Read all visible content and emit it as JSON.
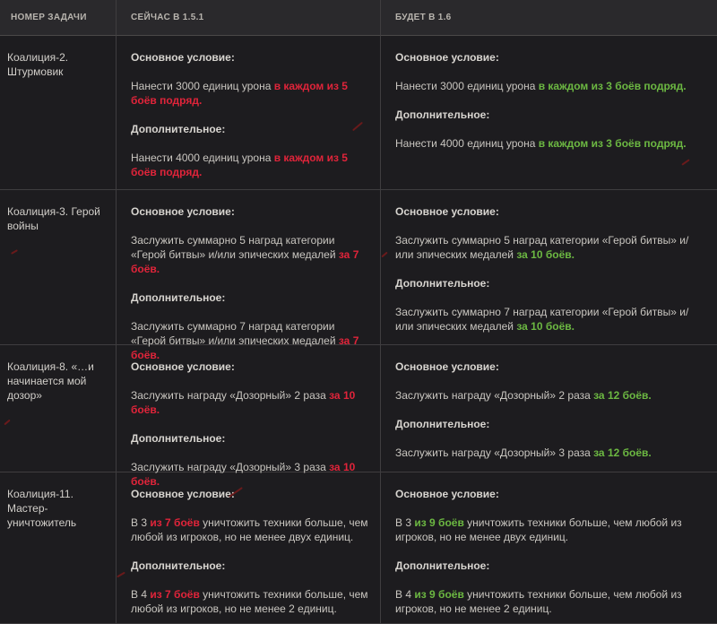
{
  "header": {
    "col1": "НОМЕР ЗАДАЧИ",
    "col2": "СЕЙЧАС В 1.5.1",
    "col3": "БУДЕТ В 1.6"
  },
  "rows": [
    {
      "name": "Коалиция-2. Штурмовик",
      "now": {
        "main_label": "Основное условие:",
        "main_text": "Нанести 3000 единиц урона ",
        "main_hl": "в каждом из 5 боёв подряд.",
        "add_label": "Дополнительное:",
        "add_text": "Нанести 4000 единиц урона ",
        "add_hl": "в каждом из 5 боёв подряд."
      },
      "next": {
        "main_label": "Основное условие:",
        "main_text": "Нанести 3000 единиц урона ",
        "main_hl": "в каждом из 3 боёв подряд.",
        "add_label": "Дополнительное:",
        "add_text": "Нанести 4000 единиц урона ",
        "add_hl": "в каждом из 3 боёв подряд."
      }
    },
    {
      "name": "Коалиция-3. Герой войны",
      "now": {
        "main_label": "Основное условие:",
        "main_text": "Заслужить суммарно 5 наград категории «Герой битвы» и/или эпических медалей ",
        "main_hl": "за 7 боёв.",
        "add_label": "Дополнительное:",
        "add_text": "Заслужить суммарно 7 наград категории «Герой битвы» и/или эпических медалей ",
        "add_hl": "за 7 боёв."
      },
      "next": {
        "main_label": "Основное условие:",
        "main_text": "Заслужить суммарно 5 наград категории «Герой битвы» и/или эпических медалей ",
        "main_hl": "за 10 боёв.",
        "add_label": "Дополнительное:",
        "add_text": "Заслужить суммарно 7 наград категории «Герой битвы» и/или эпических медалей ",
        "add_hl": "за 10 боёв."
      }
    },
    {
      "name": "Коалиция-8. «…и начинается мой дозор»",
      "now": {
        "main_label": "Основное условие:",
        "main_text": "Заслужить награду «Дозорный» 2 раза ",
        "main_hl": "за 10 боёв.",
        "add_label": "Дополнительное:",
        "add_text": "Заслужить награду «Дозорный» 3 раза ",
        "add_hl": "за 10 боёв."
      },
      "next": {
        "main_label": "Основное условие:",
        "main_text": "Заслужить награду «Дозорный» 2 раза ",
        "main_hl": "за 12 боёв.",
        "add_label": "Дополнительное:",
        "add_text": "Заслужить награду «Дозорный» 3 раза ",
        "add_hl": "за 12 боёв."
      }
    },
    {
      "name": "Коалиция-11. Мастер-уничтожитель",
      "now": {
        "main_label": "Основное условие:",
        "main_pre": "В 3 ",
        "main_hl": "из 7 боёв",
        "main_post": " уничтожить техники больше, чем любой из игроков, но не менее двух единиц.",
        "add_label": "Дополнительное:",
        "add_pre": "В 4 ",
        "add_hl": "из 7 боёв",
        "add_post": " уничтожить техники больше, чем любой из игроков, но не менее 2 единиц."
      },
      "next": {
        "main_label": "Основное условие:",
        "main_pre": "В 3 ",
        "main_hl": "из 9 боёв",
        "main_post": " уничтожить техники больше, чем любой из игроков, но не менее двух единиц.",
        "add_label": "Дополнительное:",
        "add_pre": "В 4 ",
        "add_hl": "из 9 боёв",
        "add_post": " уничтожить техники больше, чем любой из игроков, но не менее 2 единиц."
      }
    }
  ],
  "colors": {
    "background": "#1d1c1f",
    "header_bg": "#2a292c",
    "current_highlight": "#e0243a",
    "future_highlight": "#6cb842"
  }
}
